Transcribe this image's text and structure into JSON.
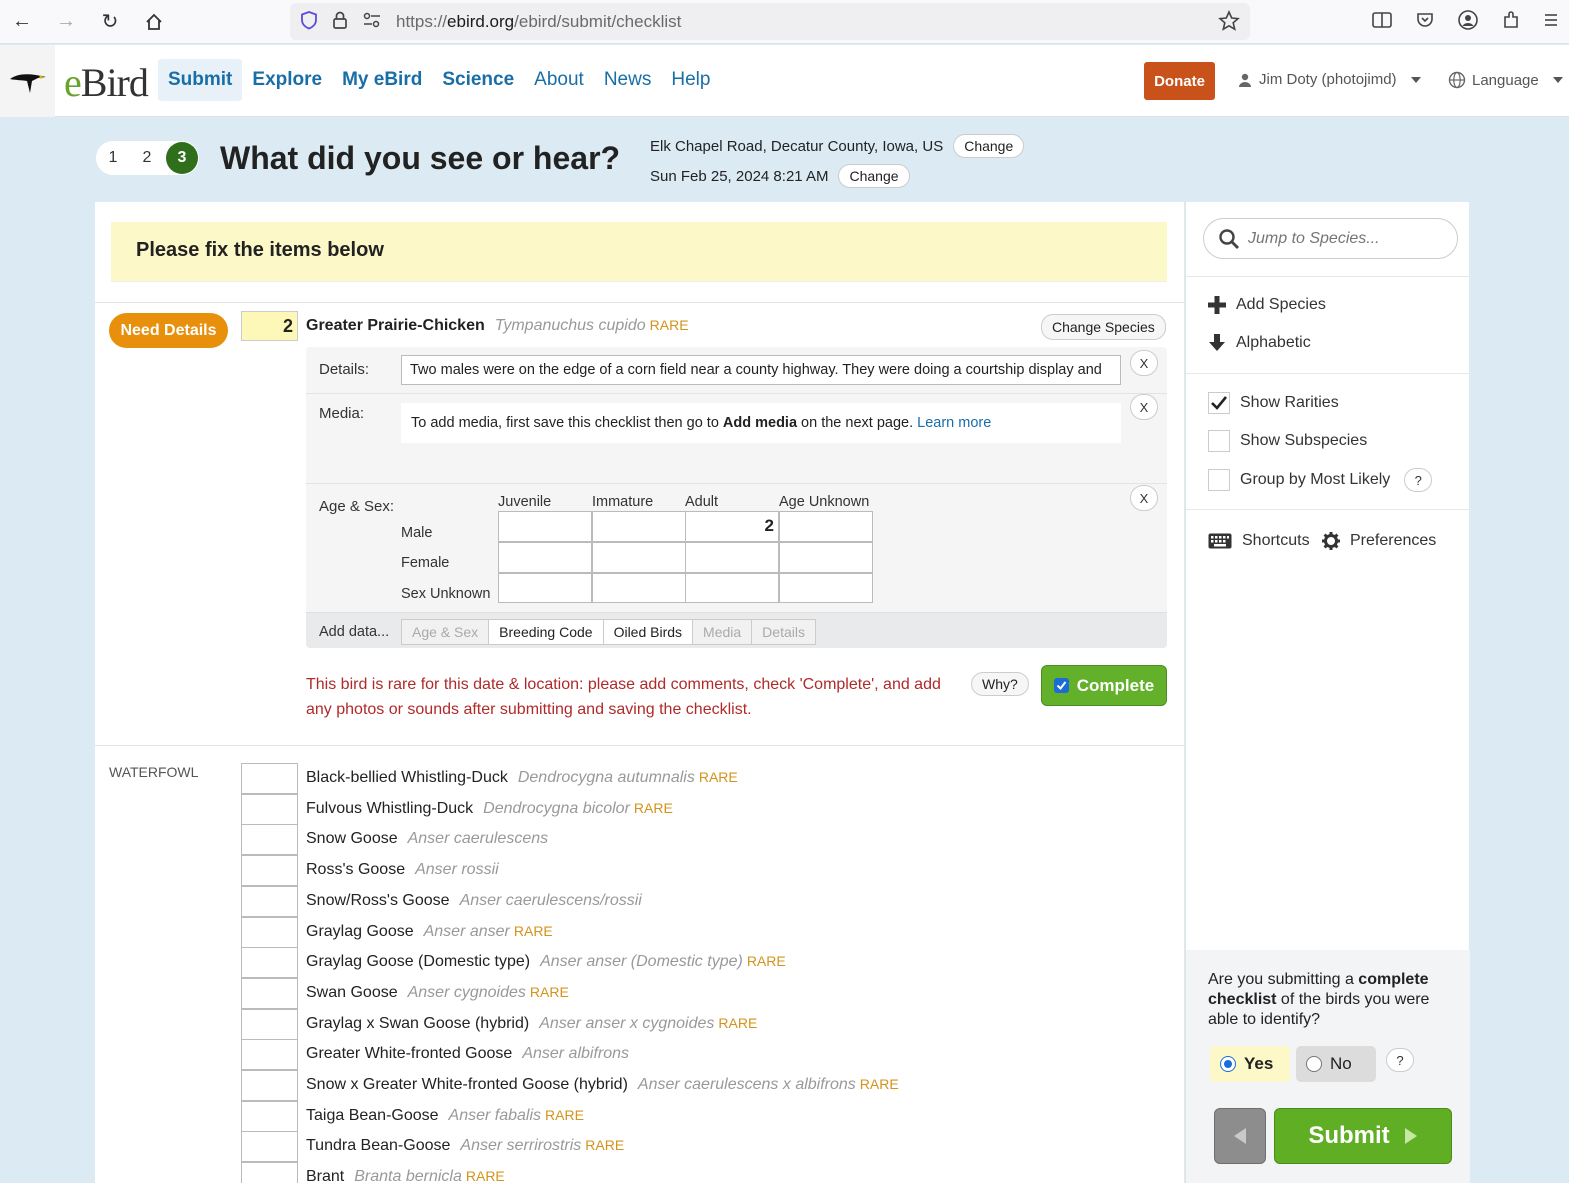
{
  "browser": {
    "url_prefix": "https://",
    "url_domain": "ebird.org",
    "url_path": "/ebird/submit/checklist"
  },
  "header": {
    "logo": "eBird",
    "logo_e": "e",
    "logo_bird": "Bird",
    "nav": [
      "Submit",
      "Explore",
      "My eBird",
      "Science",
      "About",
      "News",
      "Help"
    ],
    "donate": "Donate",
    "user": "Jim Doty (photojimd)",
    "language": "Language"
  },
  "steps": [
    "1",
    "2",
    "3"
  ],
  "title": "What did you see or hear?",
  "location": "Elk Chapel Road, Decatur County, Iowa, US",
  "datetime": "Sun Feb 25, 2024 8:21 AM",
  "change_label": "Change",
  "warning": "Please fix the items below",
  "flagged": {
    "badge": "Need Details",
    "count": "2",
    "common": "Greater Prairie-Chicken",
    "scientific": "Tympanuchus cupido",
    "rare": "RARE",
    "change_species": "Change Species",
    "details_label": "Details:",
    "details_text": "Two males were on the edge of a corn field near a county highway. They were doing a courtship display and",
    "media_label": "Media:",
    "media_text_pre": "To add media, first save this checklist then go to ",
    "media_text_bold": "Add media",
    "media_text_post": " on the next page. ",
    "media_link": "Learn more",
    "age_sex_label": "Age & Sex:",
    "age_columns": [
      "Juvenile",
      "Immature",
      "Adult",
      "Age Unknown"
    ],
    "sex_rows": [
      "Male",
      "Female",
      "Sex Unknown"
    ],
    "male_adult": "2",
    "add_data_label": "Add data...",
    "add_data_tabs": [
      "Age & Sex",
      "Breeding Code",
      "Oiled Birds",
      "Media",
      "Details"
    ],
    "x_label": "X",
    "rare_message": "This bird is rare for this date & location: please add comments, check 'Complete', and add any photos or sounds after submitting and saving the checklist.",
    "why": "Why?",
    "complete": "Complete"
  },
  "group_label": "WATERFOWL",
  "species": [
    {
      "common": "Black-bellied Whistling-Duck",
      "scientific": "Dendrocygna autumnalis",
      "rare": "RARE"
    },
    {
      "common": "Fulvous Whistling-Duck",
      "scientific": "Dendrocygna bicolor",
      "rare": "RARE"
    },
    {
      "common": "Snow Goose",
      "scientific": "Anser caerulescens",
      "rare": ""
    },
    {
      "common": "Ross's Goose",
      "scientific": "Anser rossii",
      "rare": ""
    },
    {
      "common": "Snow/Ross's Goose",
      "scientific": "Anser caerulescens/rossii",
      "rare": ""
    },
    {
      "common": "Graylag Goose",
      "scientific": "Anser anser",
      "rare": "RARE"
    },
    {
      "common": "Graylag Goose (Domestic type)",
      "scientific": "Anser anser (Domestic type)",
      "rare": "RARE"
    },
    {
      "common": "Swan Goose",
      "scientific": "Anser cygnoides",
      "rare": "RARE"
    },
    {
      "common": "Graylag x Swan Goose (hybrid)",
      "scientific": "Anser anser x cygnoides",
      "rare": "RARE"
    },
    {
      "common": "Greater White-fronted Goose",
      "scientific": "Anser albifrons",
      "rare": ""
    },
    {
      "common": "Snow x Greater White-fronted Goose (hybrid)",
      "scientific": "Anser caerulescens x albifrons",
      "rare": "RARE"
    },
    {
      "common": "Taiga Bean-Goose",
      "scientific": "Anser fabalis",
      "rare": "RARE"
    },
    {
      "common": "Tundra Bean-Goose",
      "scientific": "Anser serrirostris",
      "rare": "RARE"
    },
    {
      "common": "Brant",
      "scientific": "Branta bernicla",
      "rare": "RARE"
    }
  ],
  "sidebar": {
    "jump_placeholder": "Jump to Species...",
    "add_species": "Add Species",
    "alphabetic": "Alphabetic",
    "show_rarities": "Show Rarities",
    "show_subspecies": "Show Subspecies",
    "group_by_likely": "Group by Most Likely",
    "help": "?",
    "shortcuts": "Shortcuts",
    "preferences": "Preferences",
    "complete_q_pre": "Are you submitting a ",
    "complete_q_bold": "complete checklist",
    "complete_q_post": " of the birds you were able to identify?",
    "yes": "Yes",
    "no": "No",
    "submit": "Submit"
  }
}
